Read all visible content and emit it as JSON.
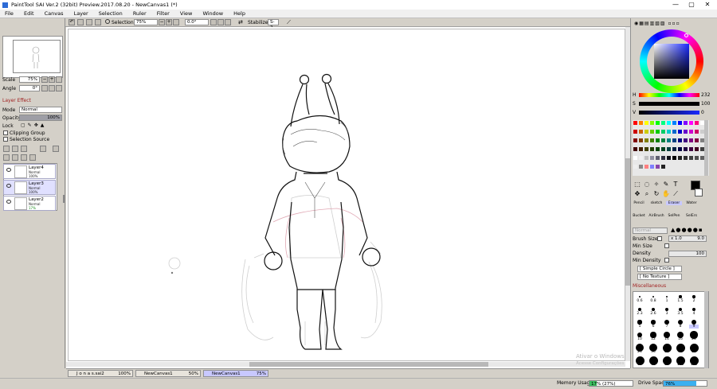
{
  "window": {
    "title": "PaintTool SAI Ver.2 (32bit) Preview.2017.08.20 - NewCanvas1 (*)",
    "min": "—",
    "max": "▢",
    "close": "✕"
  },
  "menu": [
    "File",
    "Edit",
    "Canvas",
    "Layer",
    "Selection",
    "Ruler",
    "Filter",
    "View",
    "Window",
    "Help"
  ],
  "toolbar": {
    "selection_label": "Selection",
    "zoom": "75%",
    "angle": "0.0°",
    "stabilizer_label": "Stabilizer",
    "stabilizer_value": "S-2"
  },
  "navigator": {
    "scale_label": "Scale",
    "scale_value": "75%",
    "angle_label": "Angle",
    "angle_value": "0°"
  },
  "layer_panel": {
    "effect_label": "Layer Effect",
    "mode_label": "Mode",
    "mode_value": "Normal",
    "opacity_label": "Opacity",
    "opacity_value": "100%",
    "lock_label": "Lock",
    "clipping_group": "Clipping Group",
    "selection_source": "Selection Source",
    "layers": [
      {
        "name": "Layer4",
        "mode": "Normal",
        "opacity": "100%"
      },
      {
        "name": "Layer3",
        "mode": "Normal",
        "opacity": "100%"
      },
      {
        "name": "Layer2",
        "mode": "Normal",
        "opacity": "17%"
      }
    ]
  },
  "color": {
    "h_label": "H",
    "h_value": "232",
    "s_label": "S",
    "s_value": "100",
    "v_label": "V",
    "v_value": "0",
    "swatches": [
      "#ff0000",
      "#ff8000",
      "#ffff00",
      "#80ff00",
      "#00ff00",
      "#00ff80",
      "#00ffff",
      "#0080ff",
      "#0000ff",
      "#8000ff",
      "#ff00ff",
      "#ff0080",
      "#ffffff"
    ]
  },
  "tools": {
    "pencil": "Pencil",
    "sketch": "sketch",
    "eraser": "Eraser",
    "water": "Water",
    "bucket": "Bucket",
    "airbrush": "AirBrush",
    "selpen": "SelPen",
    "selers": "SelErs",
    "normal": "Normal"
  },
  "brush": {
    "size_label": "Brush Size",
    "size_mult": "x 1.0",
    "size_value": "9.0",
    "min_size_label": "Min Size",
    "density_label": "Density",
    "density_value": "100",
    "min_density_label": "Min Density",
    "shape": "[ Simple Circle ]",
    "texture": "[ No Texture ]",
    "misc_label": "Miscellaneous",
    "sizes": [
      "0.6",
      "0.8",
      "1",
      "1.5",
      "2",
      "2.3",
      "2.6",
      "3",
      "3.5",
      "4",
      "5",
      "6",
      "7",
      "8",
      "9",
      "10",
      "12",
      "14",
      "16",
      "20",
      "25",
      "30",
      "35",
      "40",
      "50",
      "60",
      "70",
      "80",
      "100",
      "120"
    ]
  },
  "tabs": [
    {
      "name": "J o n a s.sai2",
      "zoom": "100%"
    },
    {
      "name": "NewCanvas1",
      "zoom": "50%"
    },
    {
      "name": "NewCanvas1",
      "zoom": "75%"
    }
  ],
  "status": {
    "memory_label": "Memory Usage",
    "memory_value": "17%",
    "memory_paren": "(27%)",
    "drive_label": "Drive Space",
    "drive_value": "76%"
  },
  "watermark": {
    "line1": "Ativar o Windows",
    "line2": "Acesse Configurações"
  }
}
